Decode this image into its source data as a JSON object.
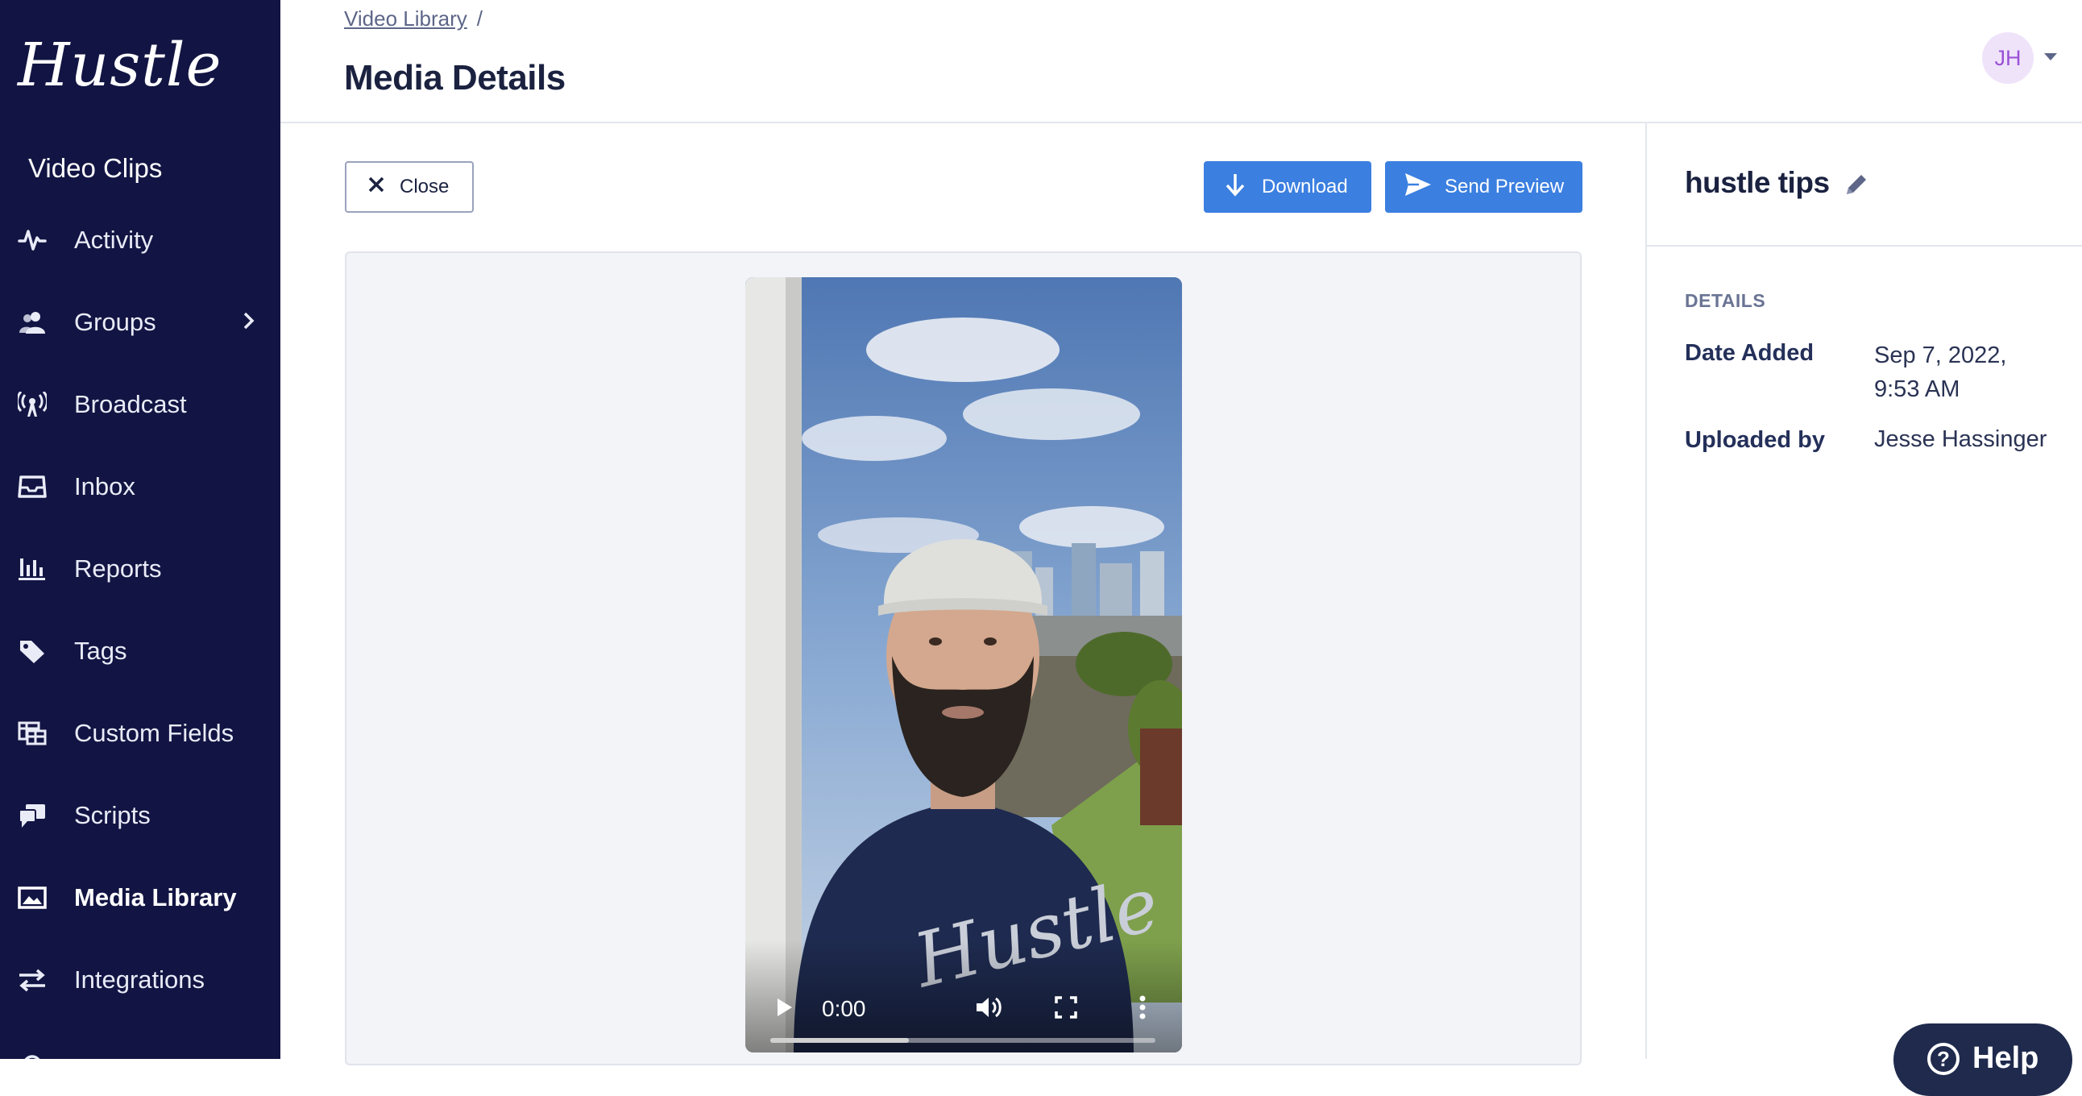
{
  "app": {
    "logo": "Hustle",
    "workspace": "Video Clips"
  },
  "sidebar": {
    "items": [
      {
        "label": "Activity",
        "icon": "activity-icon"
      },
      {
        "label": "Groups",
        "icon": "users-icon"
      },
      {
        "label": "Broadcast",
        "icon": "broadcast-icon"
      },
      {
        "label": "Inbox",
        "icon": "inbox-icon"
      },
      {
        "label": "Reports",
        "icon": "bar-chart-icon"
      },
      {
        "label": "Tags",
        "icon": "tag-icon"
      },
      {
        "label": "Custom Fields",
        "icon": "table-icon"
      },
      {
        "label": "Scripts",
        "icon": "chat-bubbles-icon"
      },
      {
        "label": "Media Library",
        "icon": "image-icon",
        "active": true
      },
      {
        "label": "Integrations",
        "icon": "swap-arrows-icon"
      }
    ]
  },
  "header": {
    "breadcrumb_link": "Video Library",
    "breadcrumb_sep": "/",
    "title": "Media Details",
    "user_initials": "JH"
  },
  "toolbar": {
    "close_label": "Close",
    "download_label": "Download",
    "send_preview_label": "Send Preview"
  },
  "player": {
    "time": "0:00",
    "progress_fraction": 0.36
  },
  "media": {
    "name": "hustle tips",
    "details_heading": "DETAILS",
    "date_added_label": "Date Added",
    "date_added_value_line1": "Sep 7, 2022,",
    "date_added_value_line2": "9:53 AM",
    "uploaded_by_label": "Uploaded by",
    "uploaded_by_value": "Jesse Hassinger"
  },
  "help": {
    "label": "Help"
  },
  "colors": {
    "sidebar_bg": "#121543",
    "primary": "#3b7fe0",
    "avatar_bg": "#efe3fa",
    "avatar_text": "#9a52d6"
  }
}
